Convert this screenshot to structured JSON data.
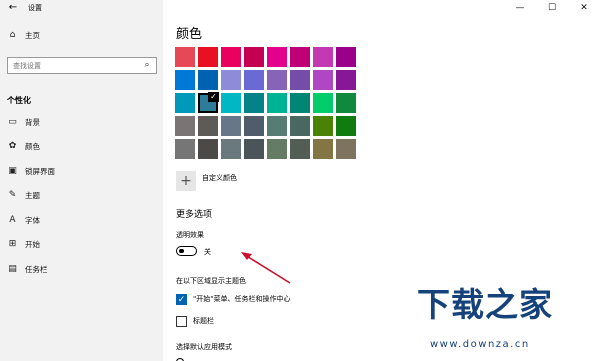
{
  "titlebar": {
    "back_icon": "back-arrow-icon",
    "title": "设置",
    "controls": {
      "minimize": "—",
      "maximize": "☐",
      "close": "✕"
    }
  },
  "sidebar": {
    "home_label": "主页",
    "search_placeholder": "查找设置",
    "section_title": "个性化",
    "items": [
      {
        "label": "背景",
        "icon": "image-icon"
      },
      {
        "label": "颜色",
        "icon": "palette-icon"
      },
      {
        "label": "锁屏界面",
        "icon": "lock-screen-icon"
      },
      {
        "label": "主题",
        "icon": "theme-icon"
      },
      {
        "label": "字体",
        "icon": "font-icon"
      },
      {
        "label": "开始",
        "icon": "start-icon"
      },
      {
        "label": "任务栏",
        "icon": "taskbar-icon"
      }
    ]
  },
  "main": {
    "title": "颜色",
    "swatches": [
      [
        "#e74856",
        "#e81123",
        "#ea005e",
        "#c30052",
        "#e3008c",
        "#bf0077",
        "#c239b3",
        "#9a0089"
      ],
      [
        "#0078d7",
        "#0063b1",
        "#8e8cd8",
        "#6b69d6",
        "#8764b8",
        "#744da9",
        "#b146c2",
        "#881798"
      ],
      [
        "#0099bc",
        "#2d7d9a",
        "#00b7c3",
        "#038387",
        "#00b294",
        "#018574",
        "#00cc6a",
        "#10893e"
      ],
      [
        "#7a7574",
        "#5d5a58",
        "#68768a",
        "#515c6b",
        "#567c73",
        "#486860",
        "#498205",
        "#107c10"
      ],
      [
        "#767676",
        "#4c4a48",
        "#69797e",
        "#4a5459",
        "#647c64",
        "#525e54",
        "#847545",
        "#7e735f"
      ]
    ],
    "selected": {
      "row": 2,
      "col": 1
    },
    "custom_color_label": "自定义颜色",
    "more_options_title": "更多选项",
    "transparency_label": "透明效果",
    "transparency_state": "关",
    "show_accent_label": "在以下区域显示主题色",
    "checkbox_start": {
      "label": "\"开始\"菜单、任务栏和操作中心",
      "checked": true
    },
    "checkbox_titlebar": {
      "label": "标题栏",
      "checked": false
    },
    "app_mode_label": "选择默认应用模式"
  },
  "annotation": {
    "arrow_color": "#c8102e"
  },
  "watermark": {
    "title": "下载之家",
    "url": "www.downza.cn",
    "color": "#15427a"
  }
}
